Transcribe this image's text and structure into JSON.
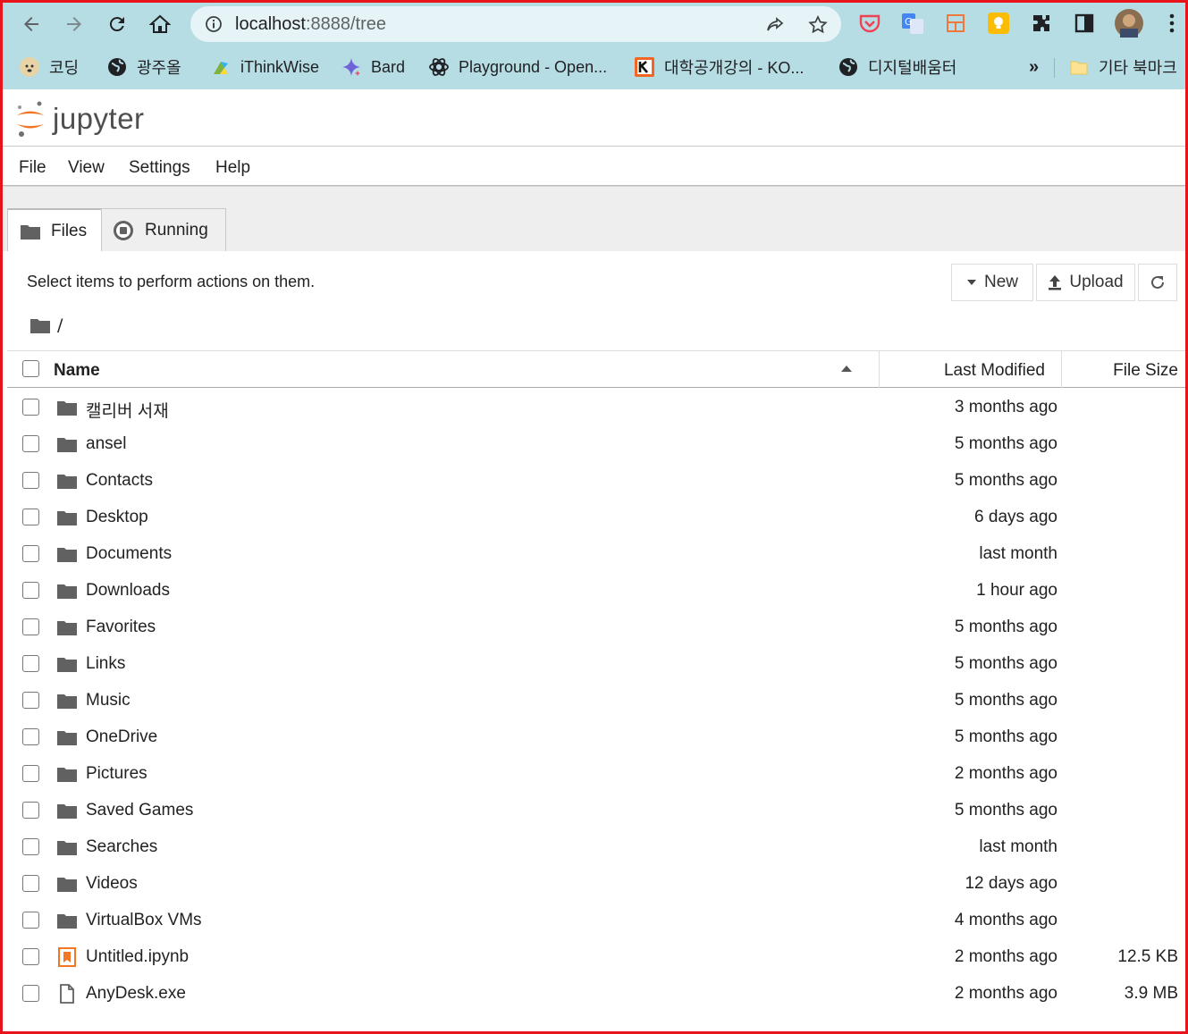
{
  "browser": {
    "url_host": "localhost",
    "url_path": ":8888/tree",
    "bookmarks": [
      {
        "label": "코딩",
        "icon": "dog-icon"
      },
      {
        "label": "광주올",
        "icon": "globe-icon"
      },
      {
        "label": "iThinkWise",
        "icon": "ithinkwise-icon"
      },
      {
        "label": "Bard",
        "icon": "bard-sparkle-icon"
      },
      {
        "label": "Playground - Open...",
        "icon": "openai-icon"
      },
      {
        "label": "대학공개강의 - KO...",
        "icon": "kocw-icon"
      },
      {
        "label": "디지털배움터",
        "icon": "globe-icon"
      }
    ],
    "overflow_label": "»",
    "other_bookmarks": "기타 북마크"
  },
  "app": {
    "logo_text": "jupyter",
    "menu": [
      "File",
      "View",
      "Settings",
      "Help"
    ],
    "tabs": [
      {
        "label": "Files",
        "icon": "folder-icon",
        "active": true
      },
      {
        "label": "Running",
        "icon": "stop-circle-icon",
        "active": false
      }
    ],
    "toolbar": {
      "hint": "Select items to perform actions on them.",
      "new_label": "New",
      "upload_label": "Upload"
    },
    "breadcrumb": "/",
    "columns": {
      "name": "Name",
      "modified": "Last Modified",
      "size": "File Size"
    }
  },
  "files": [
    {
      "name": "캘리버 서재",
      "modified": "3 months ago",
      "size": "",
      "type": "folder"
    },
    {
      "name": "ansel",
      "modified": "5 months ago",
      "size": "",
      "type": "folder"
    },
    {
      "name": "Contacts",
      "modified": "5 months ago",
      "size": "",
      "type": "folder"
    },
    {
      "name": "Desktop",
      "modified": "6 days ago",
      "size": "",
      "type": "folder"
    },
    {
      "name": "Documents",
      "modified": "last month",
      "size": "",
      "type": "folder"
    },
    {
      "name": "Downloads",
      "modified": "1 hour ago",
      "size": "",
      "type": "folder"
    },
    {
      "name": "Favorites",
      "modified": "5 months ago",
      "size": "",
      "type": "folder"
    },
    {
      "name": "Links",
      "modified": "5 months ago",
      "size": "",
      "type": "folder"
    },
    {
      "name": "Music",
      "modified": "5 months ago",
      "size": "",
      "type": "folder"
    },
    {
      "name": "OneDrive",
      "modified": "5 months ago",
      "size": "",
      "type": "folder"
    },
    {
      "name": "Pictures",
      "modified": "2 months ago",
      "size": "",
      "type": "folder"
    },
    {
      "name": "Saved Games",
      "modified": "5 months ago",
      "size": "",
      "type": "folder"
    },
    {
      "name": "Searches",
      "modified": "last month",
      "size": "",
      "type": "folder"
    },
    {
      "name": "Videos",
      "modified": "12 days ago",
      "size": "",
      "type": "folder"
    },
    {
      "name": "VirtualBox VMs",
      "modified": "4 months ago",
      "size": "",
      "type": "folder"
    },
    {
      "name": "Untitled.ipynb",
      "modified": "2 months ago",
      "size": "12.5 KB",
      "type": "notebook"
    },
    {
      "name": "AnyDesk.exe",
      "modified": "2 months ago",
      "size": "3.9 MB",
      "type": "file"
    }
  ],
  "colors": {
    "chrome_bg": "#b6dde3",
    "frame_border": "#e8141b",
    "jupyter_orange": "#f37626"
  }
}
